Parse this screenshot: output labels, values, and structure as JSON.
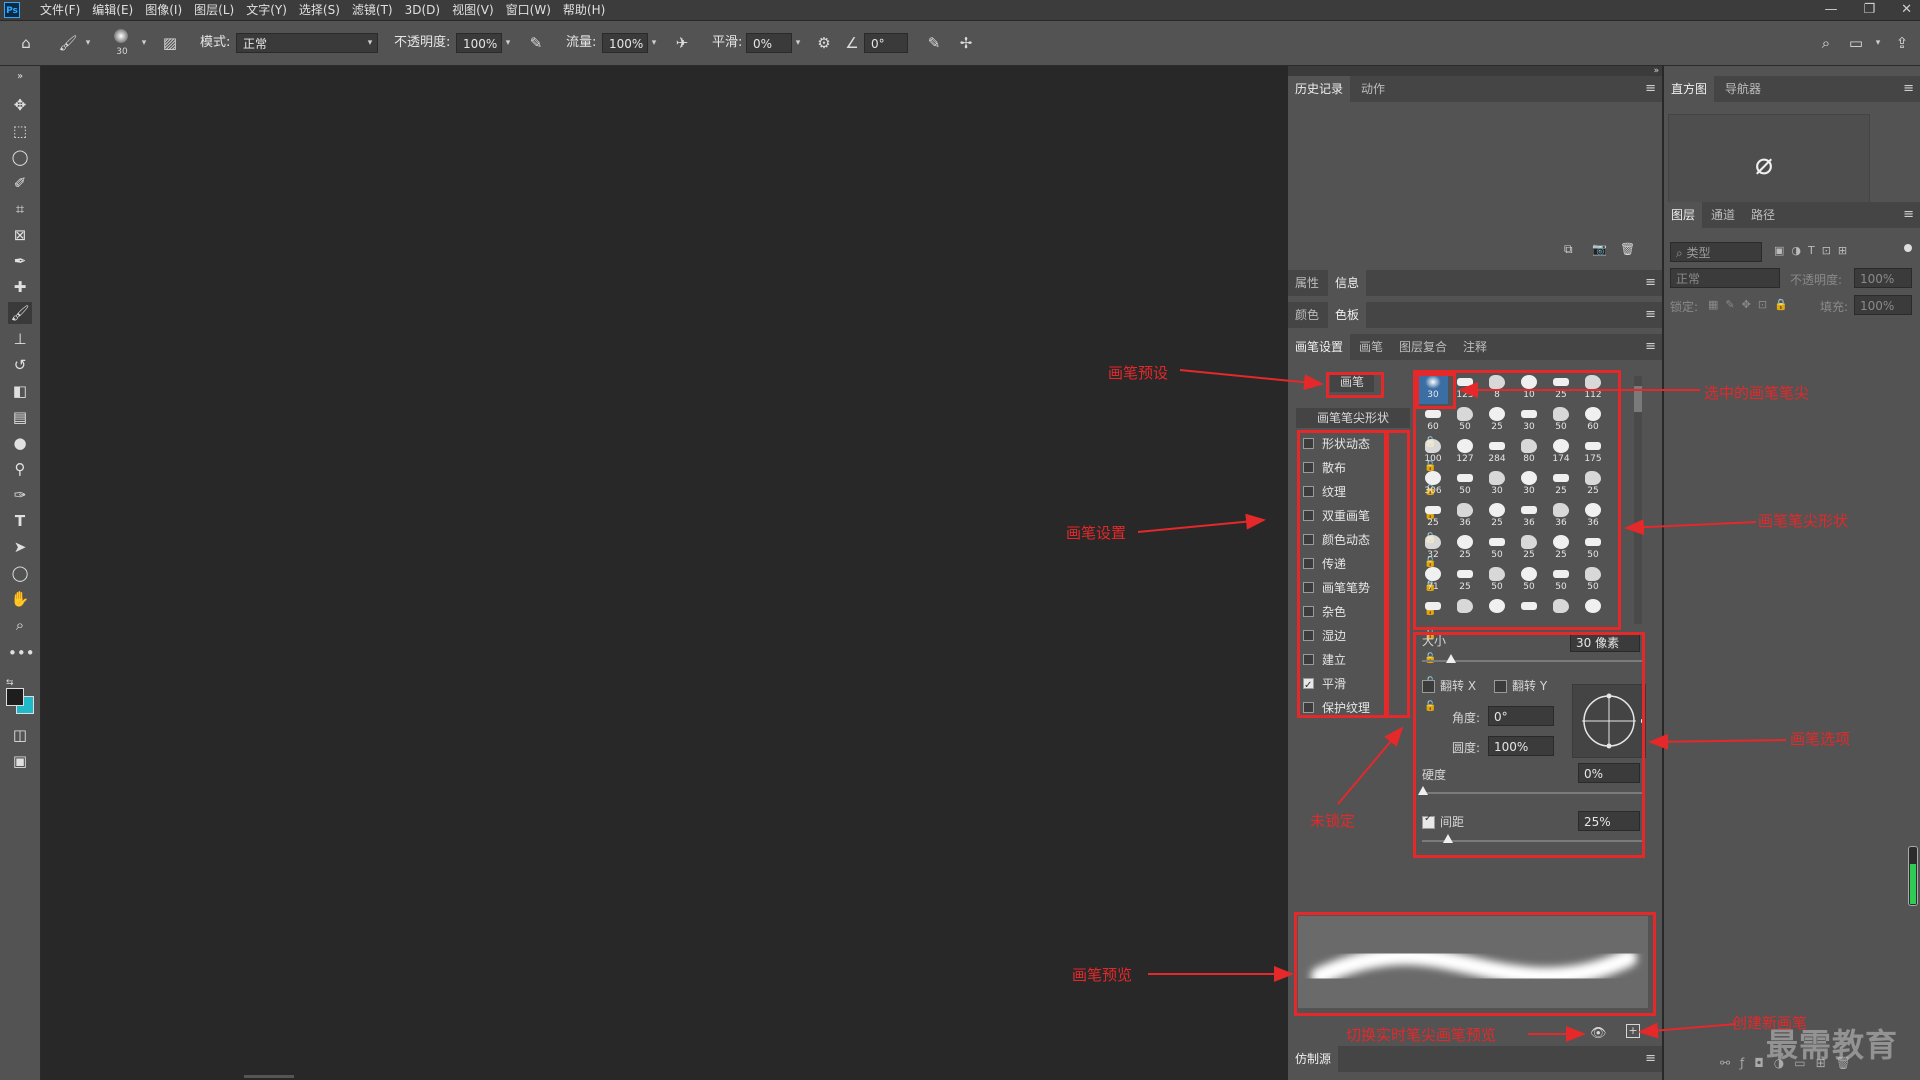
{
  "app": {
    "logo": "Ps"
  },
  "menu": [
    "文件(F)",
    "编辑(E)",
    "图像(I)",
    "图层(L)",
    "文字(Y)",
    "选择(S)",
    "滤镜(T)",
    "3D(D)",
    "视图(V)",
    "窗口(W)",
    "帮助(H)"
  ],
  "window_controls": {
    "minimize": "—",
    "restore": "❐",
    "close": "✕"
  },
  "options_bar": {
    "brush_size": "30",
    "mode_label": "模式:",
    "mode_value": "正常",
    "opacity_label": "不透明度:",
    "opacity_value": "100%",
    "flow_label": "流量:",
    "flow_value": "100%",
    "smooth_label": "平滑:",
    "smooth_value": "0%",
    "angle_value": "0°"
  },
  "panels": {
    "history_tabs": [
      "历史记录",
      "动作"
    ],
    "props_tabs": [
      "属性",
      "信息"
    ],
    "color_tabs": [
      "颜色",
      "色板"
    ],
    "brush_tabs": [
      "画笔设置",
      "画笔",
      "图层复合",
      "注释"
    ],
    "clone_source_tab": "仿制源",
    "histogram_tabs": [
      "直方图",
      "导航器"
    ],
    "layers_tabs": [
      "图层",
      "通道",
      "路径"
    ],
    "layers": {
      "search_placeholder": "类型",
      "blend_mode": "正常",
      "opacity_label": "不透明度:",
      "opacity_value": "100%",
      "lock_label": "锁定:",
      "fill_label": "填充:",
      "fill_value": "100%"
    }
  },
  "brush_settings": {
    "preset_button": "画笔",
    "tip_shape_header": "画笔笔尖形状",
    "options": [
      {
        "label": "形状动态",
        "checked": false
      },
      {
        "label": "散布",
        "checked": false
      },
      {
        "label": "纹理",
        "checked": false
      },
      {
        "label": "双重画笔",
        "checked": false
      },
      {
        "label": "颜色动态",
        "checked": false
      },
      {
        "label": "传递",
        "checked": false
      },
      {
        "label": "画笔笔势",
        "checked": false
      },
      {
        "label": "杂色",
        "checked": false
      },
      {
        "label": "湿边",
        "checked": false
      },
      {
        "label": "建立",
        "checked": false
      },
      {
        "label": "平滑",
        "checked": true
      },
      {
        "label": "保护纹理",
        "checked": false
      }
    ],
    "tip_sizes": [
      [
        "30",
        "123",
        "8",
        "10",
        "25",
        "112"
      ],
      [
        "60",
        "50",
        "25",
        "30",
        "50",
        "60"
      ],
      [
        "100",
        "127",
        "284",
        "80",
        "174",
        "175"
      ],
      [
        "306",
        "50",
        "30",
        "30",
        "25",
        "25"
      ],
      [
        "25",
        "36",
        "25",
        "36",
        "36",
        "36"
      ],
      [
        "32",
        "25",
        "50",
        "25",
        "25",
        "50"
      ],
      [
        "71",
        "25",
        "50",
        "50",
        "50",
        "50"
      ],
      [
        "",
        "",
        "",
        "",
        "",
        ""
      ]
    ],
    "size_label": "大小",
    "size_value": "30 像素",
    "flip_x": "翻转 X",
    "flip_y": "翻转 Y",
    "angle_label": "角度:",
    "angle_value": "0°",
    "roundness_label": "圆度:",
    "roundness_value": "100%",
    "hardness_label": "硬度",
    "hardness_value": "0%",
    "spacing_label": "间距",
    "spacing_value": "25%",
    "spacing_checked": true
  },
  "annotations": {
    "brush_preset": "画笔预设",
    "brush_settings": "画笔设置",
    "unlocked": "未锁定",
    "brush_preview": "画笔预览",
    "selected_tip": "选中的画笔笔尖",
    "tip_shape": "画笔笔尖形状",
    "brush_options": "画笔选项",
    "create_new_brush": "创建新画笔",
    "toggle_live_preview": "切换实时笔尖画笔预览"
  },
  "watermark": "最需教育",
  "colors": {
    "annotation": "#e5282a",
    "foreground": "#1e1e1e",
    "background": "#1fb9c9"
  }
}
